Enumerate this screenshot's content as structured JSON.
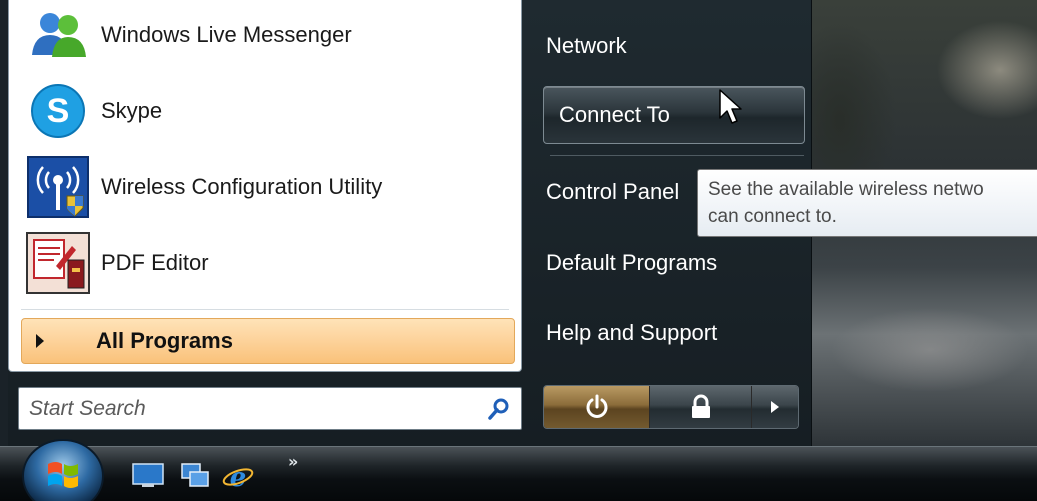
{
  "programs": [
    {
      "label": "Windows Live Messenger",
      "icon": "messenger-icon"
    },
    {
      "label": "Skype",
      "icon": "skype-icon"
    },
    {
      "label": "Wireless Configuration Utility",
      "icon": "wireless-config-icon"
    },
    {
      "label": "PDF Editor",
      "icon": "pdf-editor-icon"
    }
  ],
  "all_programs_label": "All Programs",
  "search": {
    "placeholder": "Start Search"
  },
  "right_pane": {
    "network": "Network",
    "connect_to": "Connect To",
    "control_panel": "Control Panel",
    "default_programs": "Default Programs",
    "help_support": "Help and Support"
  },
  "tooltip": {
    "line1": "See the available wireless netwo",
    "line2": "can connect to."
  },
  "taskbar": {
    "chevron": "»"
  },
  "colors": {
    "all_programs_bg": "#fdd29a",
    "menu_dark": "#1f2a30",
    "skype_blue": "#1fa0e3",
    "accent_power": "#8b6c3a"
  }
}
